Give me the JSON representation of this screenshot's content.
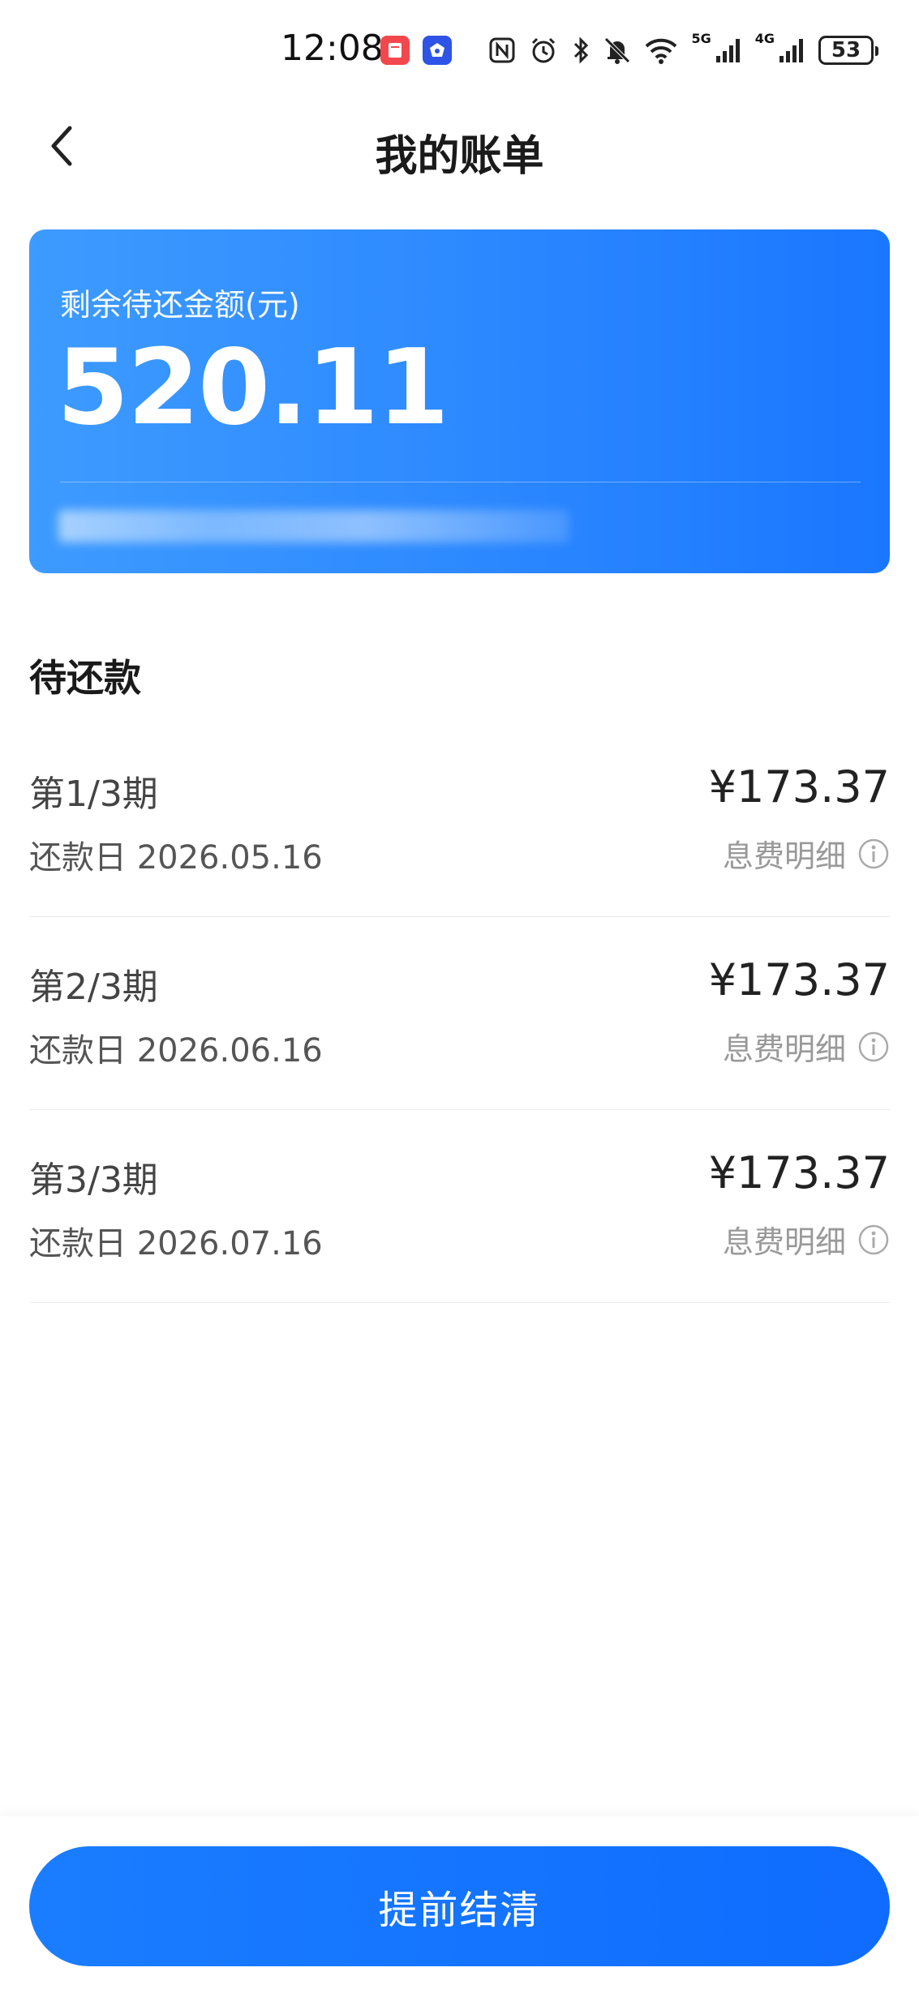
{
  "status_bar": {
    "time": "12:08",
    "network_1": "5G",
    "network_2": "4G",
    "battery": "53"
  },
  "nav": {
    "title": "我的账单"
  },
  "balance": {
    "label": "剩余待还金额(元)",
    "amount": "520.11"
  },
  "pending": {
    "title": "待还款",
    "items": [
      {
        "period": "第1/3期",
        "due_date": "还款日 2026.05.16",
        "amount": "¥173.37",
        "fee_label": "息费明细"
      },
      {
        "period": "第2/3期",
        "due_date": "还款日 2026.06.16",
        "amount": "¥173.37",
        "fee_label": "息费明细"
      },
      {
        "period": "第3/3期",
        "due_date": "还款日 2026.07.16",
        "amount": "¥173.37",
        "fee_label": "息费明细"
      }
    ]
  },
  "footer": {
    "settle_label": "提前结清"
  },
  "colors": {
    "brand_blue": "#1a77ff",
    "card_light": "#3d9bff",
    "muted_text": "#999999"
  }
}
